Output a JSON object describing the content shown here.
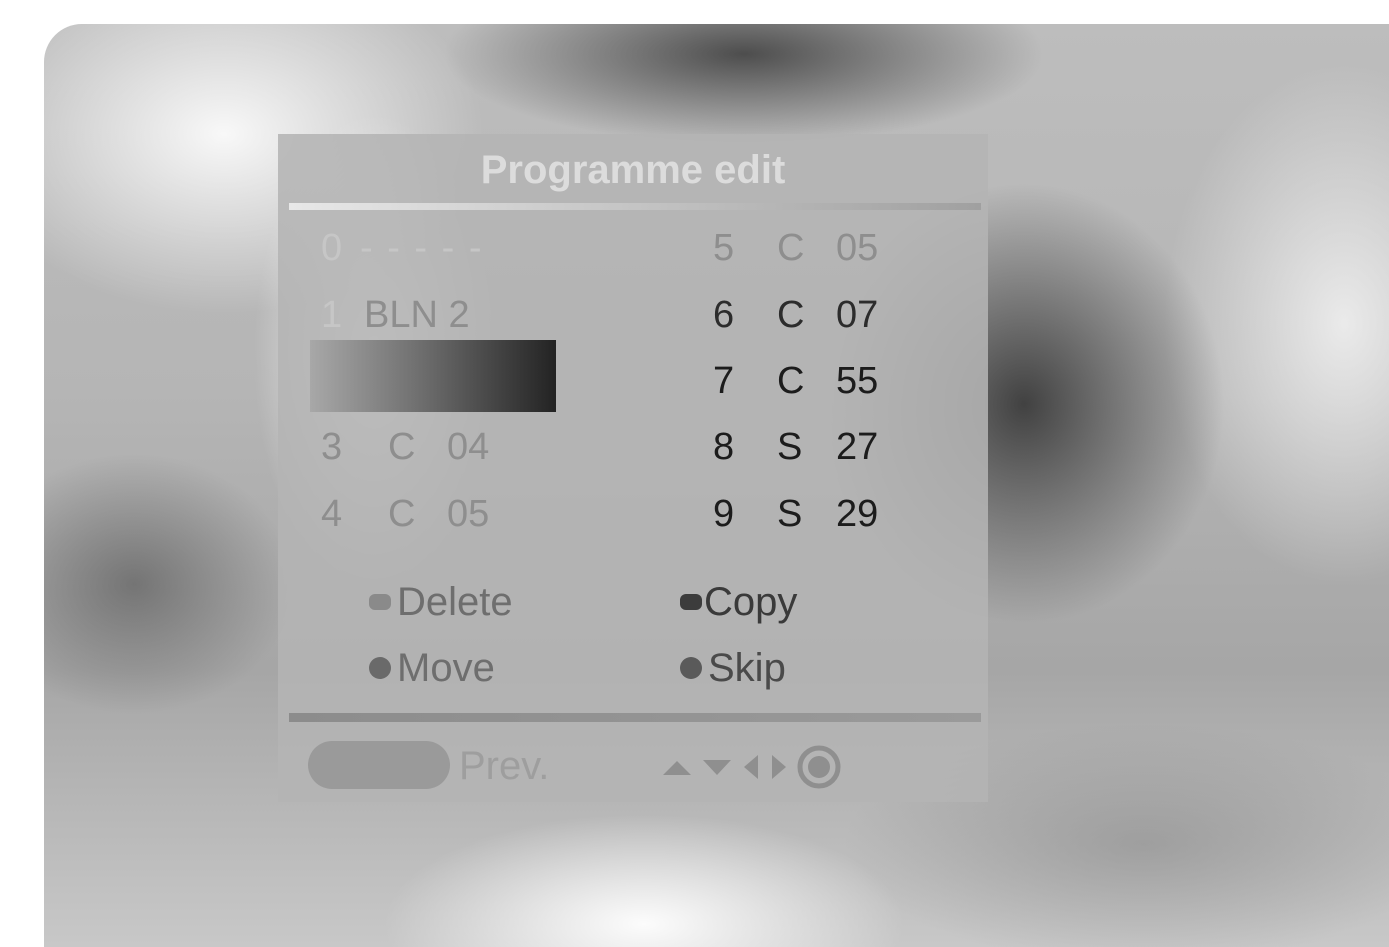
{
  "menu": {
    "title": "Programme edit"
  },
  "programmes": [
    {
      "num": "0",
      "label": "- - - - -"
    },
    {
      "num": "1",
      "label": "BLN 2"
    },
    {
      "num": "",
      "label": ""
    },
    {
      "num": "3",
      "code": "C",
      "ch": "04"
    },
    {
      "num": "4",
      "code": "C",
      "ch": "05"
    },
    {
      "num": "5",
      "code": "C",
      "ch": "05"
    },
    {
      "num": "6",
      "code": "C",
      "ch": "07"
    },
    {
      "num": "7",
      "code": "C",
      "ch": "55"
    },
    {
      "num": "8",
      "code": "S",
      "ch": "27"
    },
    {
      "num": "9",
      "code": "S",
      "ch": "29"
    }
  ],
  "legend": {
    "delete": "Delete",
    "copy": "Copy",
    "move": "Move",
    "skip": "Skip"
  },
  "footer": {
    "prev_label": "Prev."
  },
  "colors": {
    "delete_dot": "#8a8a8a",
    "copy_dot": "#3c3c3c",
    "move_dot": "#6a6a6a",
    "skip_dot": "#5a5a5a"
  },
  "icons": [
    "up-arrow-icon",
    "down-arrow-icon",
    "left-arrow-icon",
    "right-arrow-icon",
    "ok-icon"
  ]
}
